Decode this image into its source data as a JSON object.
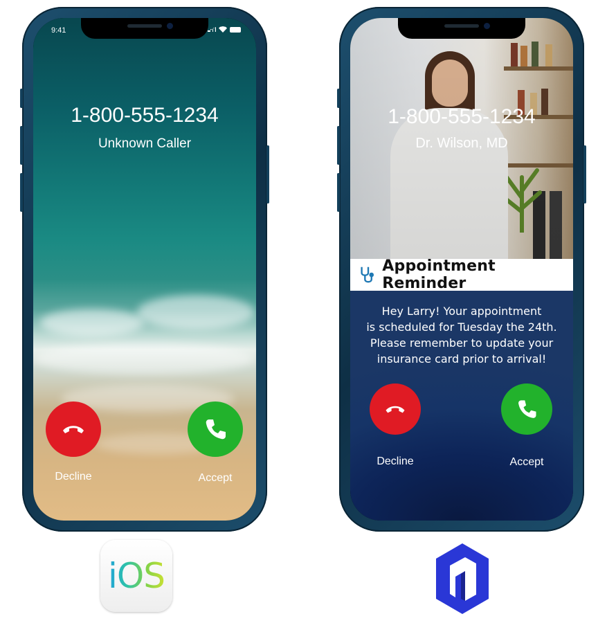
{
  "ios_phone": {
    "status_time": "9:41",
    "caller_number": "1-800-555-1234",
    "caller_name": "Unknown Caller",
    "decline_label": "Decline",
    "accept_label": "Accept"
  },
  "branded_phone": {
    "caller_number": "1-800-555-1234",
    "caller_name": "Dr. Wilson, MD",
    "banner_title": "Appointment Reminder",
    "banner_icon": "stethoscope-icon",
    "message_lines": [
      "Hey Larry! Your appointment",
      "is scheduled for Tuesday the 24th.",
      "Please remember to update your",
      "insurance card prior to arrival!"
    ],
    "decline_label": "Decline",
    "accept_label": "Accept"
  },
  "logos": {
    "ios_logo_text": "iOS",
    "brand_logo": "brand-hexagon-logo"
  },
  "colors": {
    "decline": "#e01b24",
    "accept": "#22b22c",
    "phone_frame": "#1d4f6e",
    "brand_blue": "#2a37d6"
  }
}
